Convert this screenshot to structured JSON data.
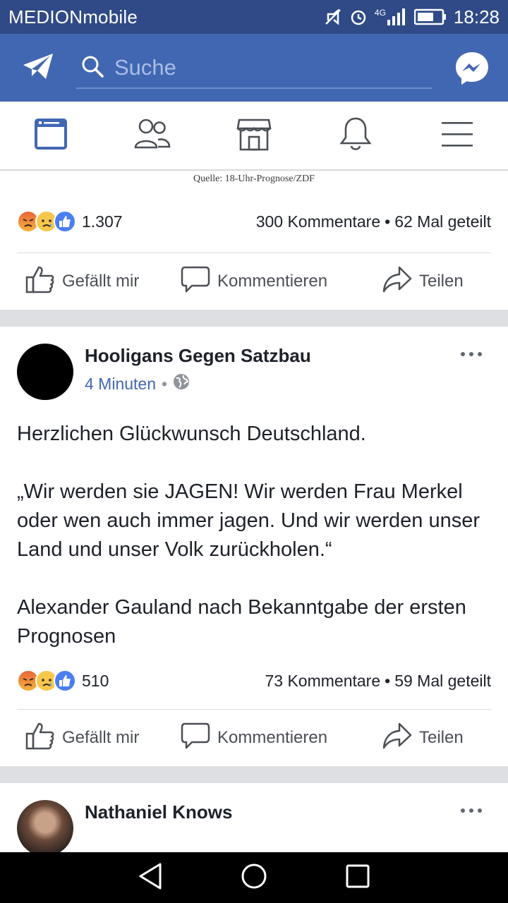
{
  "status_bar": {
    "carrier": "MEDIONmobile",
    "network": "4G",
    "time": "18:28"
  },
  "app_bar": {
    "search_placeholder": "Suche"
  },
  "nav_tabs": [
    {
      "name": "news-feed",
      "icon": "news-feed-icon",
      "active": true
    },
    {
      "name": "friends",
      "icon": "friends-icon",
      "active": false
    },
    {
      "name": "marketplace",
      "icon": "marketplace-icon",
      "active": false
    },
    {
      "name": "notifications",
      "icon": "bell-icon",
      "active": false
    },
    {
      "name": "menu",
      "icon": "menu-icon",
      "active": false
    }
  ],
  "post1": {
    "image_caption": "Quelle: 18-Uhr-Prognose/ZDF",
    "reaction_count": "1.307",
    "comments": "300 Kommentare",
    "shares": "62 Mal geteilt",
    "separator": "•"
  },
  "actions": {
    "like": "Gefällt mir",
    "comment": "Kommentieren",
    "share": "Teilen"
  },
  "post2": {
    "author": "Hooligans Gegen Satzbau",
    "time": "4 Minuten",
    "separator": "•",
    "body": [
      "Herzlichen Glückwunsch Deutschland.",
      "",
      "„Wir werden sie JAGEN! Wir werden Frau Merkel oder wen auch immer jagen. Und wir werden unser Land und unser Volk zurückholen.“",
      "",
      "Alexander Gauland nach Bekanntgabe der ersten Prognosen"
    ],
    "reaction_count": "510",
    "comments": "73 Kommentare",
    "shares": "59 Mal geteilt"
  },
  "post3": {
    "author": "Nathaniel Knows"
  },
  "colors": {
    "status_bar": "#2f4a86",
    "app_bar": "#4267b2",
    "link_blue": "#4267b2",
    "feed_bg": "#dddfe2"
  }
}
